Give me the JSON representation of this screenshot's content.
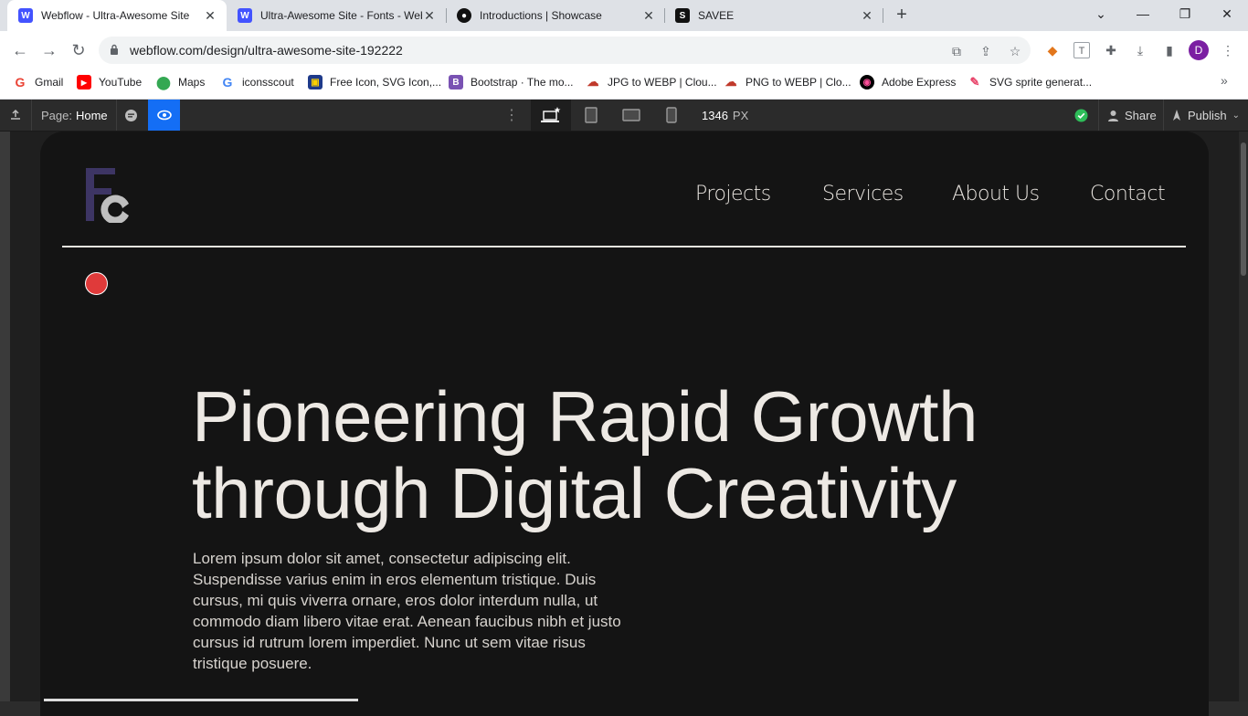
{
  "browser": {
    "tabs": [
      {
        "title": "Webflow - Ultra-Awesome Site",
        "icon": "webflow-icon",
        "active": true
      },
      {
        "title": "Ultra-Awesome Site - Fonts - Webflow",
        "icon": "webflow-icon",
        "active": false
      },
      {
        "title": "Introductions | Showcase",
        "icon": "showcase-icon",
        "active": false
      },
      {
        "title": "SAVEE",
        "icon": "savee-icon",
        "active": false
      }
    ],
    "url": "webflow.com/design/ultra-awesome-site-192222",
    "profile_initial": "D",
    "bookmarks": [
      {
        "label": "Gmail",
        "icon": "gmail-icon"
      },
      {
        "label": "YouTube",
        "icon": "youtube-icon"
      },
      {
        "label": "Maps",
        "icon": "maps-icon"
      },
      {
        "label": "iconsscout",
        "icon": "google-icon"
      },
      {
        "label": "Free Icon, SVG Icon,...",
        "icon": "freeicon-icon"
      },
      {
        "label": "Bootstrap · The mo...",
        "icon": "bootstrap-icon"
      },
      {
        "label": "JPG to WEBP | Clou...",
        "icon": "cloud-icon"
      },
      {
        "label": "PNG to WEBP | Clo...",
        "icon": "cloud-icon"
      },
      {
        "label": "Adobe Express",
        "icon": "adobe-express-icon"
      },
      {
        "label": "SVG sprite generat...",
        "icon": "svg-sprite-icon"
      }
    ]
  },
  "webflow": {
    "page_label": "Page:",
    "page_name": "Home",
    "width_value": "1346",
    "width_unit": "PX",
    "share_label": "Share",
    "publish_label": "Publish"
  },
  "site": {
    "nav": [
      "Projects",
      "Services",
      "About Us",
      "Contact"
    ],
    "headline_line1": "Pioneering Rapid Growth",
    "headline_line2": "through Digital Creativity",
    "paragraph": "Lorem ipsum dolor sit amet, consectetur adipiscing elit. Suspendisse varius enim in eros elementum tristique. Duis cursus, mi quis viverra ornare, eros dolor interdum nulla, ut commodo diam libero vitae erat. Aenean faucibus nibh et justo cursus id rutrum lorem imperdiet. Nunc ut sem vitae risus tristique posuere."
  },
  "colors": {
    "page_bg": "#141414",
    "text": "#ede9e4",
    "accent_dot": "#e03a3a",
    "webflow_blue": "#146ef5",
    "logo_purple": "#3d3564"
  }
}
